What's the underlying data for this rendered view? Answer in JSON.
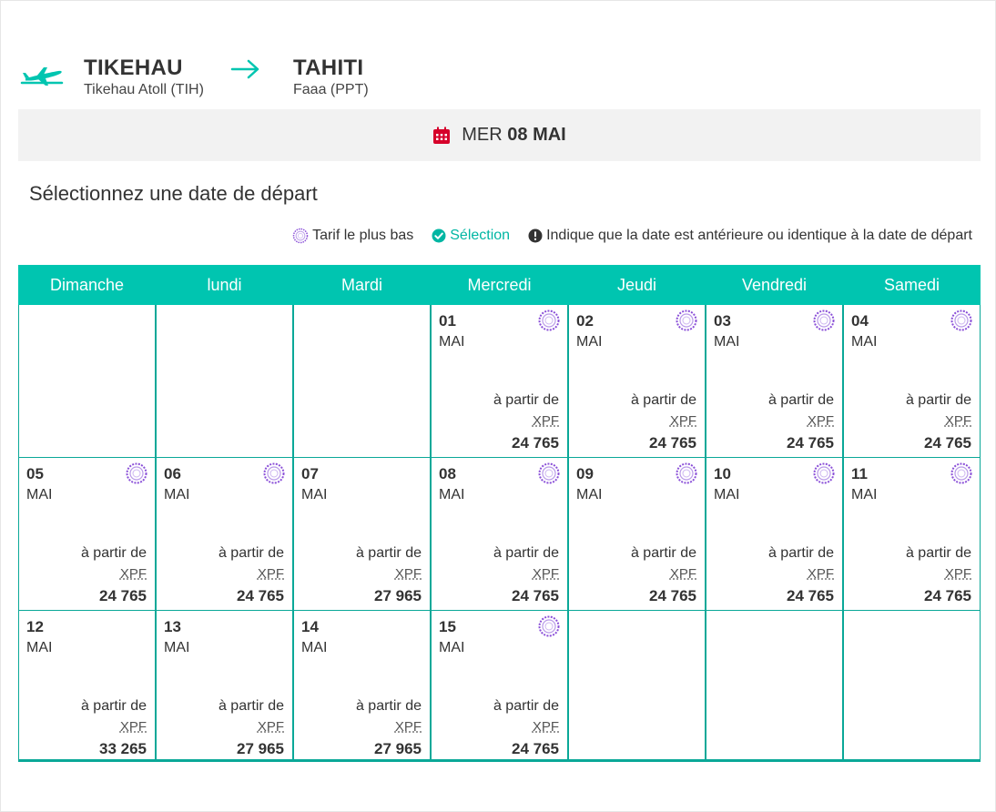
{
  "route": {
    "origin": {
      "city": "TIKEHAU",
      "airport": "Tikehau Atoll (TIH)"
    },
    "destination": {
      "city": "TAHITI",
      "airport": "Faaa (PPT)"
    }
  },
  "selected_date": {
    "weekday": "MER",
    "date": "08 MAI"
  },
  "heading": "Sélectionnez une date de départ",
  "legend": {
    "lowest": "Tarif le plus bas",
    "selection": "Sélection",
    "info": "Indique que la date est antérieure ou identique à la date de départ"
  },
  "colors": {
    "teal": "#00c5b0",
    "selection": "#00b6a3",
    "lowest": "#8a4fd8",
    "calendar_icon": "#d6002a"
  },
  "weekdays": [
    "Dimanche",
    "lundi",
    "Mardi",
    "Mercredi",
    "Jeudi",
    "Vendredi",
    "Samedi"
  ],
  "price_from_label": "à partir de",
  "currency": "XPF",
  "weeks": [
    [
      null,
      null,
      null,
      {
        "day": "01",
        "month": "MAI",
        "price": "24 765",
        "lowest": true
      },
      {
        "day": "02",
        "month": "MAI",
        "price": "24 765",
        "lowest": true
      },
      {
        "day": "03",
        "month": "MAI",
        "price": "24 765",
        "lowest": true
      },
      {
        "day": "04",
        "month": "MAI",
        "price": "24 765",
        "lowest": true
      }
    ],
    [
      {
        "day": "05",
        "month": "MAI",
        "price": "24 765",
        "lowest": true
      },
      {
        "day": "06",
        "month": "MAI",
        "price": "24 765",
        "lowest": true
      },
      {
        "day": "07",
        "month": "MAI",
        "price": "27 965",
        "lowest": false
      },
      {
        "day": "08",
        "month": "MAI",
        "price": "24 765",
        "lowest": true
      },
      {
        "day": "09",
        "month": "MAI",
        "price": "24 765",
        "lowest": true
      },
      {
        "day": "10",
        "month": "MAI",
        "price": "24 765",
        "lowest": true
      },
      {
        "day": "11",
        "month": "MAI",
        "price": "24 765",
        "lowest": true
      }
    ],
    [
      {
        "day": "12",
        "month": "MAI",
        "price": "33 265",
        "lowest": false
      },
      {
        "day": "13",
        "month": "MAI",
        "price": "27 965",
        "lowest": false
      },
      {
        "day": "14",
        "month": "MAI",
        "price": "27 965",
        "lowest": false
      },
      {
        "day": "15",
        "month": "MAI",
        "price": "24 765",
        "lowest": true
      },
      null,
      null,
      null
    ]
  ]
}
